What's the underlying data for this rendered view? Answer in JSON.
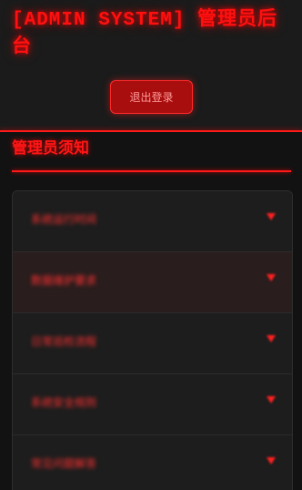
{
  "header": {
    "title": "[ADMIN SYSTEM] 管理员后台",
    "logout_label": "退出登录"
  },
  "notice": {
    "title": "管理员须知",
    "items": [
      {
        "label": "系统运行时间"
      },
      {
        "label": "数据维护要求"
      },
      {
        "label": "日常巡检流程"
      },
      {
        "label": "系统安全规则"
      },
      {
        "label": "常见问题解答"
      }
    ]
  },
  "colors": {
    "accent": "#ff1a1a",
    "button_bg": "#a90e0e",
    "background": "#1b1b1b",
    "panel": "#1d1d1d"
  }
}
